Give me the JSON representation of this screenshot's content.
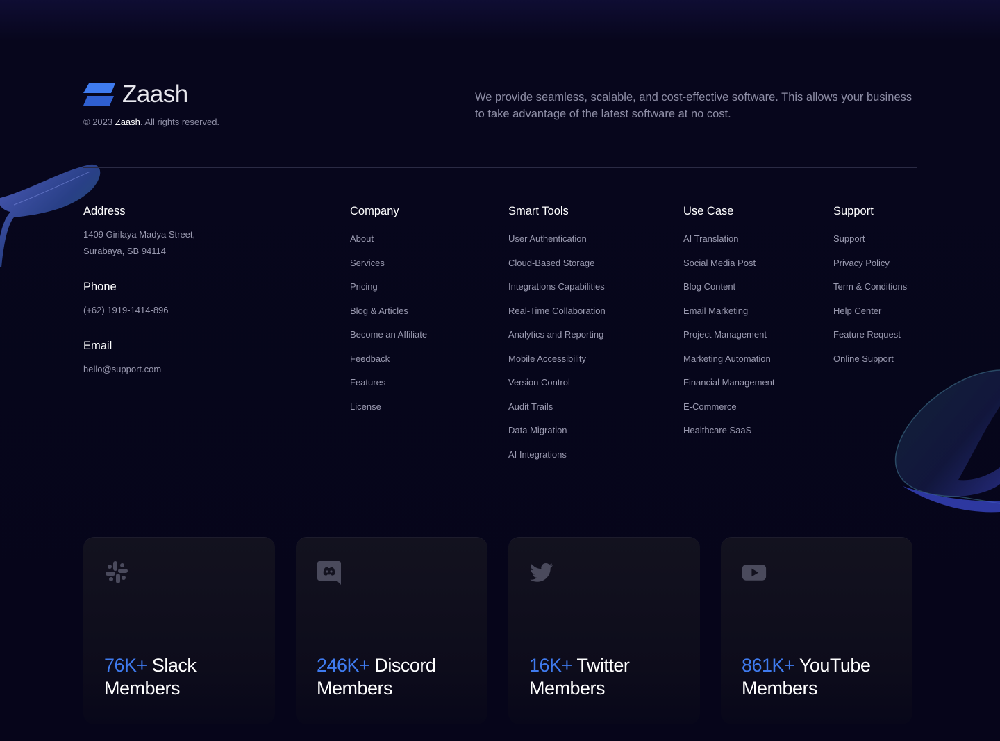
{
  "brand": {
    "name": "Zaash",
    "logo_icon": "zaash-logo-icon"
  },
  "copyright": {
    "prefix": "© 2023",
    "company": "Zaash",
    "suffix": ". All rights reserved."
  },
  "tagline": "We provide seamless, scalable, and cost-effective software. This allows your business to take advantage of the latest software at no cost.",
  "contact": {
    "address": {
      "title": "Address",
      "line1": "1409 Girilaya Madya Street,",
      "line2": "Surabaya, SB 94114"
    },
    "phone": {
      "title": "Phone",
      "value": "(+62) 1919-1414-896"
    },
    "email": {
      "title": "Email",
      "value": "hello@support.com"
    }
  },
  "columns": {
    "company": {
      "title": "Company",
      "items": [
        "About",
        "Services",
        "Pricing",
        "Blog & Articles",
        "Become an Affiliate",
        "Feedback",
        "Features",
        "License"
      ]
    },
    "tools": {
      "title": "Smart Tools",
      "items": [
        "User Authentication",
        "Cloud-Based Storage",
        "Integrations Capabilities",
        "Real-Time Collaboration",
        "Analytics and Reporting",
        "Mobile Accessibility",
        "Version Control",
        "Audit Trails",
        "Data Migration",
        "AI Integrations"
      ]
    },
    "usecase": {
      "title": "Use Case",
      "items": [
        "AI Translation",
        "Social Media Post",
        "Blog Content",
        "Email Marketing",
        "Project Management",
        "Marketing Automation",
        "Financial Management",
        "E-Commerce",
        "Healthcare SaaS"
      ]
    },
    "support": {
      "title": "Support",
      "items": [
        "Support",
        "Privacy Policy",
        "Term & Conditions",
        "Help Center",
        "Feature Request",
        "Online Support"
      ]
    }
  },
  "community": [
    {
      "icon": "slack-icon",
      "count": "76K+",
      "platform": "Slack",
      "label": "Members"
    },
    {
      "icon": "discord-icon",
      "count": "246K+",
      "platform": "Discord",
      "label": "Members"
    },
    {
      "icon": "twitter-icon",
      "count": "16K+",
      "platform": "Twitter",
      "label": "Members"
    },
    {
      "icon": "youtube-icon",
      "count": "861K+",
      "platform": "YouTube",
      "label": "Members"
    }
  ],
  "colors": {
    "background": "#06051a",
    "accent": "#3f7bef",
    "muted_text": "#9a9ab0"
  }
}
